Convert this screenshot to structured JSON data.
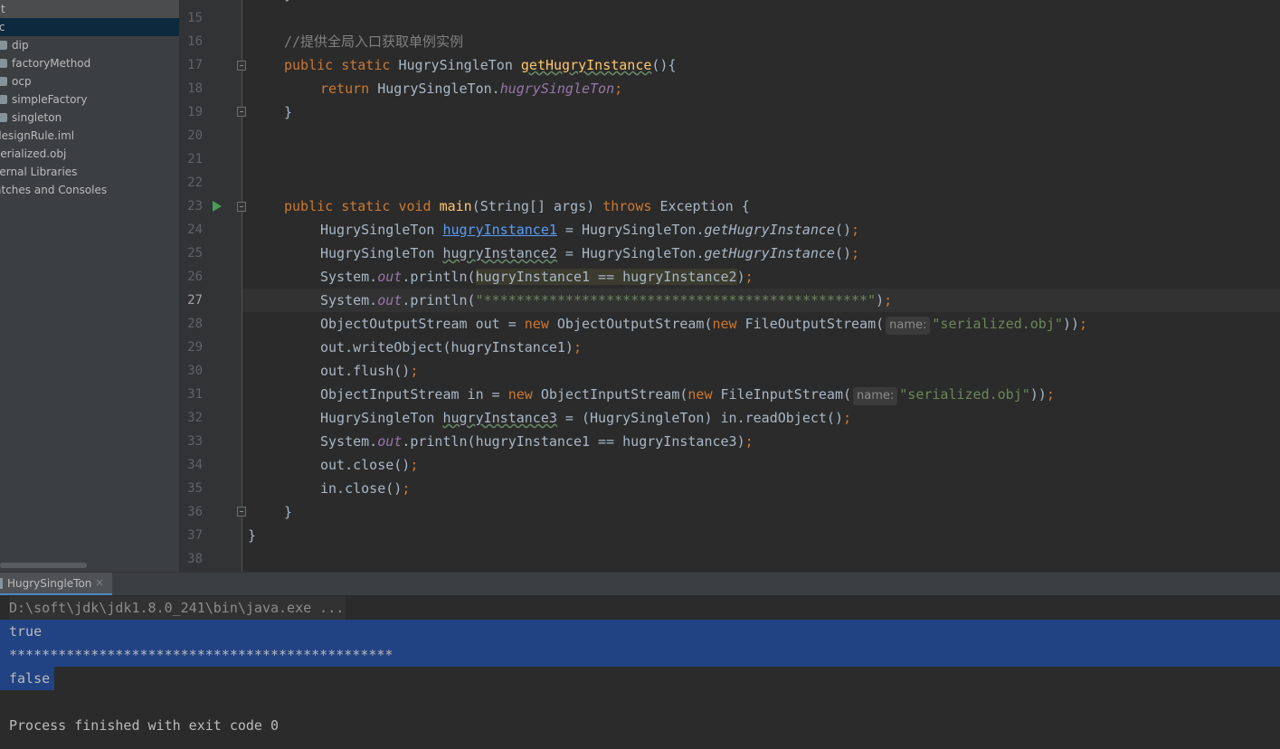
{
  "project_tree": {
    "items": [
      {
        "label": "out",
        "depth": 0,
        "selected": "grey"
      },
      {
        "label": "src",
        "depth": 0,
        "selected": "blue"
      },
      {
        "label": "dip",
        "depth": 1,
        "folder": true
      },
      {
        "label": "factoryMethod",
        "depth": 1,
        "folder": true
      },
      {
        "label": "ocp",
        "depth": 1,
        "folder": true
      },
      {
        "label": "simpleFactory",
        "depth": 1,
        "folder": true
      },
      {
        "label": "singleton",
        "depth": 1,
        "folder": true
      },
      {
        "label": "designRule.iml",
        "depth": 0
      },
      {
        "label": "serialized.obj",
        "depth": 0
      },
      {
        "label": "External Libraries",
        "depth": 0
      },
      {
        "label": "Scratches and Consoles",
        "depth": 0
      }
    ]
  },
  "editor": {
    "current_line": 27,
    "line_numbers": [
      "15",
      "16",
      "17",
      "18",
      "19",
      "20",
      "21",
      "22",
      "23",
      "24",
      "25",
      "26",
      "27",
      "28",
      "29",
      "30",
      "31",
      "32",
      "33",
      "34",
      "35",
      "36",
      "37",
      "38"
    ],
    "code": {
      "l16_comment": "//提供全局入口获取单例实例",
      "kw_public": "public",
      "kw_static": "static",
      "kw_void": "void",
      "kw_return": "return",
      "kw_throws": "throws",
      "kw_new": "new",
      "type_singleton": "HugrySingleTon",
      "fn_get_instance": "getHugryInstance",
      "field_singleton": "hugrySingleTon",
      "fn_main": "main",
      "main_params": "(String[] args)",
      "exception": "Exception {",
      "var1": "hugryInstance1",
      "var2": "hugryInstance2",
      "var3": "hugryInstance3",
      "system": "System.",
      "out_field": "out",
      "println_open": ".println(",
      "compare_12": "hugryInstance1 == hugryInstance2",
      "stars_string": "\"***********************************************\"",
      "oos_decl": "ObjectOutputStream out = ",
      "oos_ctor": "ObjectOutputStream(",
      "fos_ctor": "FileOutputStream(",
      "hint_name": "name:",
      "file_string": "\"serialized.obj\"",
      "write_object": "out.writeObject(hugryInstance1)",
      "flush": "out.flush()",
      "ois_decl": "ObjectInputStream in = ",
      "ois_ctor": "ObjectInputStream(",
      "fis_ctor": "FileInputStream(",
      "read_object": " = (HugrySingleTon) in.readObject()",
      "compare_13": "hugryInstance1 == hugryInstance3",
      "out_close": "out.close()",
      "in_close": "in.close()"
    }
  },
  "run_panel": {
    "tab_label": "HugrySingleTon",
    "close_glyph": "×",
    "command": "D:\\soft\\jdk\\jdk1.8.0_241\\bin\\java.exe ...",
    "output_lines": [
      "true",
      "***********************************************",
      "false"
    ],
    "finish_message": "Process finished with exit code 0"
  },
  "colors": {
    "keyword": "#cc7832",
    "function": "#ffc66d",
    "string": "#6a8759",
    "static_field": "#9876aa",
    "selection": "#214283"
  },
  "icons": [
    "folder-icon",
    "run-gutter-icon",
    "fold-icon",
    "close-icon"
  ]
}
